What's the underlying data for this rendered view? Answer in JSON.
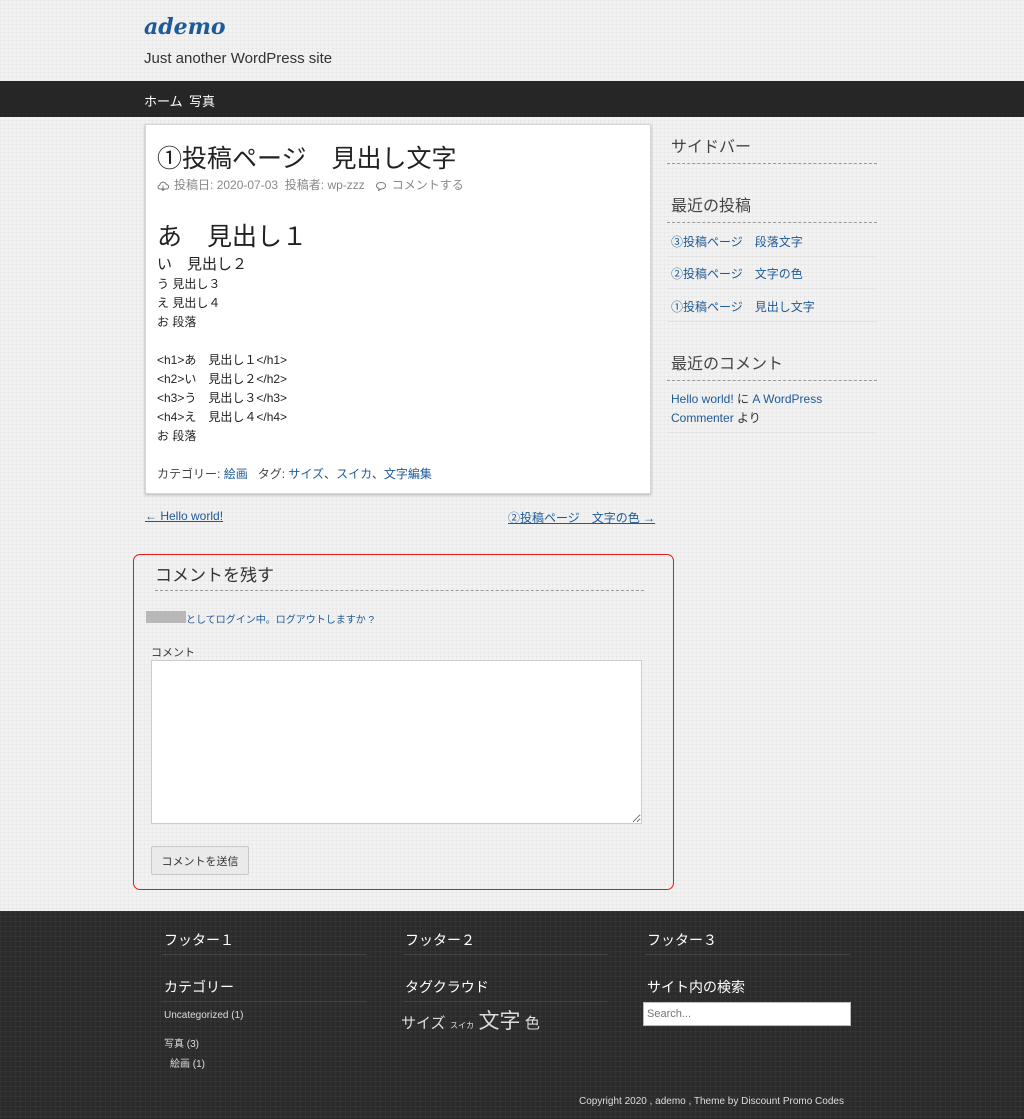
{
  "site": {
    "title": "ademo",
    "tagline": "Just another WordPress site"
  },
  "nav": [
    "ホーム",
    "写真"
  ],
  "post": {
    "title": "①投稿ページ　見出し文字",
    "posted_label": "投稿日:",
    "date": "2020-07-03",
    "author_label": "投稿者:",
    "author": "wp-zzz",
    "comment_link": "コメントする",
    "h1": "あ　見出し１",
    "h2": "い　見出し２",
    "h3": "う 見出し３",
    "h4": "え 見出し４",
    "para": "お 段落",
    "code1": "<h1>あ　見出し１</h1>",
    "code2": "<h2>い　見出し２</h2>",
    "code3": "<h3>う　見出し３</h3>",
    "code4": "<h4>え　見出し４</h4>",
    "code5": "お 段落",
    "category_label": "カテゴリー:",
    "category": "絵画",
    "tag_label": "タグ:",
    "tags": [
      "サイズ",
      "スイカ",
      "文字編集"
    ],
    "tag_sep": "、"
  },
  "post_nav": {
    "prev": "← Hello world!",
    "next": "②投稿ページ　文字の色 →"
  },
  "comment_form": {
    "title": "コメントを残す",
    "logged_in": "としてログイン中。",
    "logout": "ログアウトしますか ?",
    "label": "コメント",
    "submit": "コメントを送信"
  },
  "sidebar": {
    "title": "サイドバー",
    "recent_posts_title": "最近の投稿",
    "recent_posts": [
      "③投稿ページ　段落文字",
      "②投稿ページ　文字の色",
      "①投稿ページ　見出し文字"
    ],
    "recent_comments_title": "最近のコメント",
    "comment_post": "Hello world!",
    "comment_on": "に",
    "commenter_line1": "A WordPress",
    "commenter_line2": "Commenter",
    "comment_by": "より"
  },
  "footer": {
    "col1_title": "フッター１",
    "col2_title": "フッター２",
    "col3_title": "フッター３",
    "categories_title": "カテゴリー",
    "categories": [
      {
        "name": "Uncategorized",
        "count": "(1)"
      },
      {
        "name": "写真",
        "count": "(3)"
      },
      {
        "name": "絵画",
        "count": "(1)"
      }
    ],
    "tagcloud_title": "タグクラウド",
    "tagcloud": [
      "サイズ",
      "スイカ",
      "文字",
      "色"
    ],
    "search_title": "サイト内の検索",
    "search_placeholder": "Search...",
    "copyright": "Copyright 2020 , ademo , Theme by",
    "credit": "Discount Promo Codes"
  },
  "colors": {
    "link": "#1e5a96",
    "highlight_border": "#e21a1a",
    "nav_bg": "#262626",
    "footer_bg": "#2b2b2b"
  }
}
